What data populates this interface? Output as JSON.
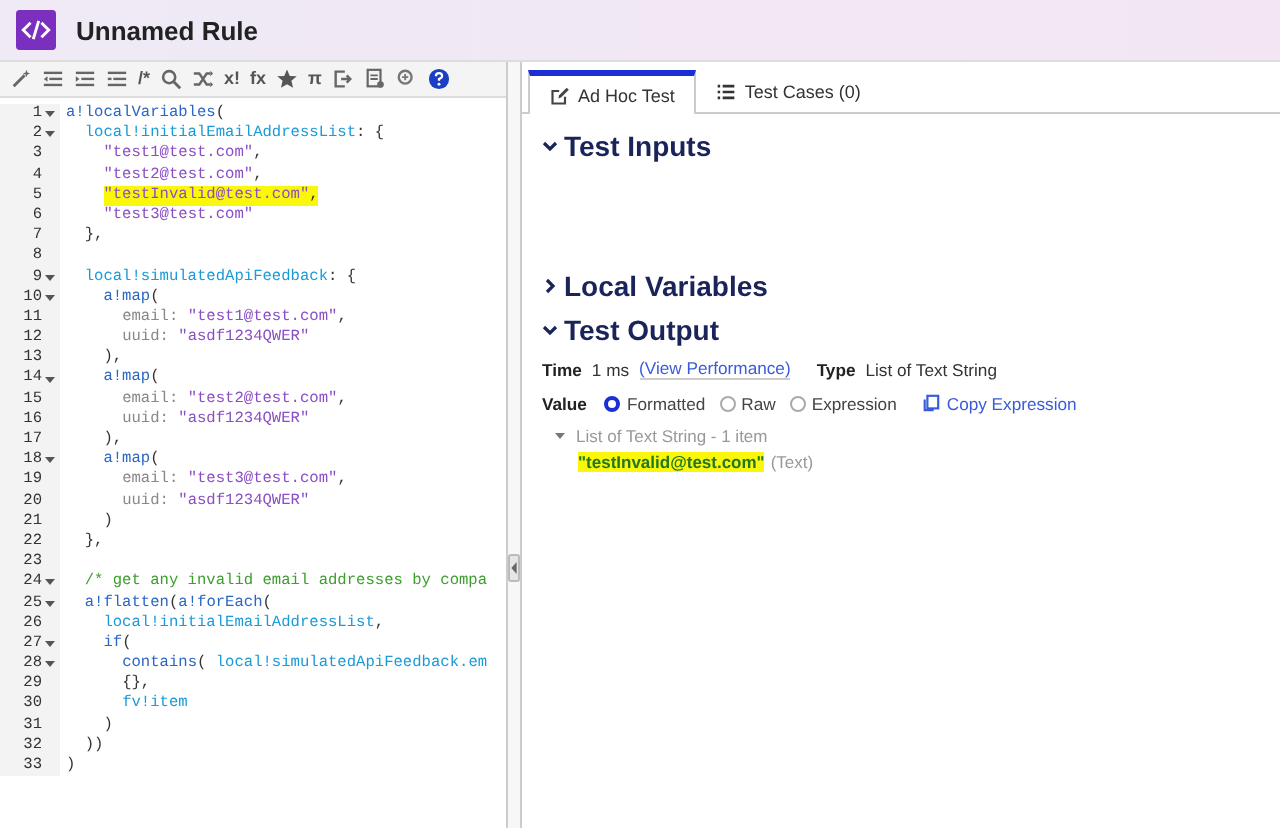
{
  "window": {
    "title": "Unnamed Rule"
  },
  "toolbar": [
    {
      "kind": "wand"
    },
    {
      "kind": "outdent"
    },
    {
      "kind": "indent"
    },
    {
      "kind": "list"
    },
    {
      "kind": "glyph",
      "text": "/*"
    },
    {
      "kind": "search"
    },
    {
      "kind": "shuffle"
    },
    {
      "kind": "glyph",
      "text": "x!"
    },
    {
      "kind": "glyph",
      "text": "fx"
    },
    {
      "kind": "star"
    },
    {
      "kind": "glyph",
      "text": "π"
    },
    {
      "kind": "export"
    },
    {
      "kind": "doc"
    },
    {
      "kind": "zoom"
    },
    {
      "kind": "help"
    }
  ],
  "editor": {
    "lines": [
      {
        "n": "1",
        "fold": true,
        "highlighted": false,
        "tokens": [
          {
            "t": "a!localVariables",
            "kind": "func"
          },
          {
            "t": "(",
            "kind": "plain"
          }
        ],
        "children": [
          {
            "n": "2",
            "fold": true,
            "highlighted": false,
            "tokens": [
              {
                "t": "local!initialEmailAddressList",
                "kind": "local"
              },
              {
                "t": ": {",
                "kind": "plain"
              }
            ],
            "children": [
              {
                "n": "3",
                "fold": false,
                "highlighted": false,
                "tokens": [
                  {
                    "t": "\"test1@test.com\"",
                    "kind": "str"
                  },
                  {
                    "t": ",",
                    "kind": "plain"
                  }
                ]
              },
              {
                "n": "4",
                "fold": false,
                "highlighted": false,
                "tokens": [
                  {
                    "t": "\"test2@test.com\"",
                    "kind": "str"
                  },
                  {
                    "t": ",",
                    "kind": "plain"
                  }
                ]
              },
              {
                "n": "5",
                "fold": false,
                "highlighted": true,
                "tokens": [
                  {
                    "t": "\"testInvalid@test.com\"",
                    "kind": "str"
                  },
                  {
                    "t": ",",
                    "kind": "plain"
                  }
                ]
              },
              {
                "n": "6",
                "fold": false,
                "highlighted": false,
                "tokens": [
                  {
                    "t": "\"test3@test.com\"",
                    "kind": "str"
                  }
                ]
              }
            ]
          },
          {
            "n": "7",
            "fold": false,
            "highlighted": false,
            "tokens": [
              {
                "t": "},",
                "kind": "plain"
              }
            ]
          },
          {
            "n": "8",
            "fold": false
          },
          {
            "n": "9",
            "fold": true,
            "highlighted": false,
            "tokens": [
              {
                "t": "local!simulatedApiFeedback",
                "kind": "local"
              },
              {
                "t": ": {",
                "kind": "plain"
              }
            ],
            "children": [
              {
                "n": "10",
                "fold": true,
                "highlighted": false,
                "tokens": [
                  {
                    "t": "a!map",
                    "kind": "func"
                  },
                  {
                    "t": "(",
                    "kind": "plain"
                  }
                ],
                "children": [
                  {
                    "n": "11",
                    "fold": false,
                    "highlighted": false,
                    "tokens": [
                      {
                        "t": "email:",
                        "kind": "key"
                      },
                      {
                        "t": "\"test1@test.com\"",
                        "kind": "str"
                      },
                      {
                        "t": ",",
                        "kind": "plain"
                      }
                    ]
                  },
                  {
                    "n": "12",
                    "fold": false,
                    "highlighted": false,
                    "tokens": [
                      {
                        "t": "uuid:",
                        "kind": "key"
                      },
                      {
                        "t": "\"asdf1234QWER\"",
                        "kind": "str"
                      }
                    ]
                  }
                ]
              },
              {
                "n": "13",
                "fold": false,
                "highlighted": false,
                "tokens": [
                  {
                    "t": "),",
                    "kind": "plain"
                  }
                ]
              },
              {
                "n": "14",
                "fold": true,
                "highlighted": false,
                "tokens": [
                  {
                    "t": "a!map",
                    "kind": "func"
                  },
                  {
                    "t": "(",
                    "kind": "plain"
                  }
                ],
                "children": [
                  {
                    "n": "15",
                    "fold": false,
                    "highlighted": false,
                    "tokens": [
                      {
                        "t": "email:",
                        "kind": "key"
                      },
                      {
                        "t": "\"test2@test.com\"",
                        "kind": "str"
                      },
                      {
                        "t": ",",
                        "kind": "plain"
                      }
                    ]
                  },
                  {
                    "n": "16",
                    "fold": false,
                    "highlighted": false,
                    "tokens": [
                      {
                        "t": "uuid:",
                        "kind": "key"
                      },
                      {
                        "t": "\"asdf1234QWER\"",
                        "kind": "str"
                      }
                    ]
                  }
                ]
              },
              {
                "n": "17",
                "fold": false,
                "highlighted": false,
                "tokens": [
                  {
                    "t": "),",
                    "kind": "plain"
                  }
                ]
              },
              {
                "n": "18",
                "fold": true,
                "highlighted": false,
                "tokens": [
                  {
                    "t": "a!map",
                    "kind": "func"
                  },
                  {
                    "t": "(",
                    "kind": "plain"
                  }
                ],
                "children": [
                  {
                    "n": "19",
                    "fold": false,
                    "highlighted": false,
                    "tokens": [
                      {
                        "t": "email:",
                        "kind": "key"
                      },
                      {
                        "t": "\"test3@test.com\"",
                        "kind": "str"
                      },
                      {
                        "t": ",",
                        "kind": "plain"
                      }
                    ]
                  },
                  {
                    "n": "20",
                    "fold": false,
                    "highlighted": false,
                    "tokens": [
                      {
                        "t": "uuid:",
                        "kind": "key"
                      },
                      {
                        "t": "\"asdf1234QWER\"",
                        "kind": "str"
                      }
                    ]
                  }
                ]
              },
              {
                "n": "21",
                "fold": false,
                "highlighted": false,
                "tokens": [
                  {
                    "t": ")",
                    "kind": "plain"
                  }
                ]
              }
            ]
          },
          {
            "n": "22",
            "fold": false,
            "highlighted": false,
            "tokens": [
              {
                "t": "},",
                "kind": "plain"
              }
            ]
          },
          {
            "n": "23",
            "fold": false
          },
          {
            "n": "24",
            "fold": true,
            "highlighted": false,
            "tokens": [
              {
                "t": "/* get any invalid email addresses by compa",
                "kind": "comment"
              }
            ]
          },
          {
            "n": "25",
            "fold": true,
            "highlighted": false,
            "tokens": [
              {
                "t": "a!flatten",
                "kind": "func"
              },
              {
                "t": "(",
                "kind": "plain"
              },
              {
                "t": "a!forEach",
                "kind": "func"
              },
              {
                "t": "(",
                "kind": "plain"
              }
            ],
            "children": [
              {
                "n": "26",
                "fold": false,
                "highlighted": false,
                "tokens": [
                  {
                    "t": "local!initialEmailAddressList",
                    "kind": "local"
                  },
                  {
                    "t": ",",
                    "kind": "plain"
                  }
                ]
              },
              {
                "n": "27",
                "fold": true,
                "highlighted": false,
                "tokens": [
                  {
                    "t": "if",
                    "kind": "func"
                  },
                  {
                    "t": "(",
                    "kind": "plain"
                  }
                ],
                "children": [
                  {
                    "n": "28",
                    "fold": true,
                    "highlighted": false,
                    "tokens": [
                      {
                        "t": "contains",
                        "kind": "func"
                      },
                      {
                        "t": "(",
                        "kind": "paren"
                      },
                      {
                        "t": "local!simulatedApiFeedback.em",
                        "kind": "local"
                      }
                    ]
                  },
                  {
                    "n": "29",
                    "fold": false,
                    "highlighted": false,
                    "tokens": [
                      {
                        "t": "{},",
                        "kind": "plain"
                      }
                    ]
                  },
                  {
                    "n": "30",
                    "fold": false,
                    "highlighted": false,
                    "tokens": [
                      {
                        "t": "fv!item",
                        "kind": "local"
                      }
                    ]
                  }
                ]
              },
              {
                "n": "31",
                "fold": false,
                "highlighted": false,
                "tokens": [
                  {
                    "t": ")",
                    "kind": "plain"
                  }
                ]
              }
            ]
          },
          {
            "n": "32",
            "fold": false,
            "highlighted": false,
            "tokens": [
              {
                "t": "))",
                "kind": "plain"
              }
            ]
          }
        ]
      },
      {
        "n": "33",
        "fold": false,
        "highlighted": false,
        "tokens": [
          {
            "t": ")",
            "kind": "plain"
          }
        ]
      }
    ]
  },
  "tabs": [
    {
      "label": "Ad Hoc Test",
      "kind": "edit",
      "selected": true
    },
    {
      "label": "Test Cases (0)",
      "kind": "list",
      "selected": false
    }
  ],
  "sections": [
    {
      "title": "Test Inputs",
      "expanded": true
    },
    {
      "title": "Local Variables",
      "expanded": false
    },
    {
      "title": "Test Output",
      "expanded": true
    }
  ],
  "output": {
    "time_label": "Time",
    "time": "1 ms",
    "performance_link": "(View Performance)",
    "type_label": "Type",
    "type": "List of Text String",
    "value_label": "Value",
    "formats": [
      {
        "label": "Formatted",
        "selected": true
      },
      {
        "label": "Raw",
        "selected": false
      },
      {
        "label": "Expression",
        "selected": false
      }
    ],
    "copy_link": "Copy Expression",
    "result": {
      "header": "List of Text String - 1 item",
      "expanded": true,
      "value": "\"testInvalid@test.com\"",
      "value_highlighted": true,
      "type": "(Text)"
    }
  }
}
